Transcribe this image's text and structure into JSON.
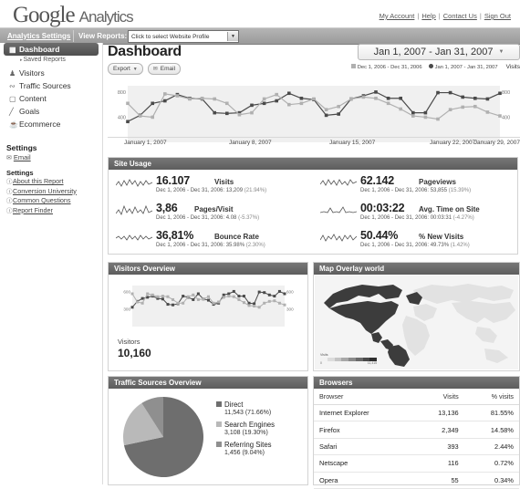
{
  "header": {
    "logo_google": "Google",
    "logo_product": "Analytics",
    "account_links": [
      "My Account",
      "Help",
      "Contact Us",
      "Sign Out"
    ]
  },
  "navbar": {
    "analytics_settings": "Analytics Settings",
    "view_reports_label": "View Reports:",
    "profile_placeholder": "Click to select Website Profile",
    "dropdown_icon": "chevron-down-icon"
  },
  "sidebar": {
    "items": [
      {
        "label": "Dashboard",
        "icon": "grid-icon",
        "active": true
      },
      {
        "label": "Visitors",
        "icon": "person-icon",
        "active": false
      },
      {
        "label": "Traffic Sources",
        "icon": "share-icon",
        "active": false
      },
      {
        "label": "Content",
        "icon": "document-icon",
        "active": false
      },
      {
        "label": "Goals",
        "icon": "flag-icon",
        "active": false
      },
      {
        "label": "Ecommerce",
        "icon": "cart-icon",
        "active": false
      }
    ],
    "saved_reports": "Saved Reports",
    "settings_heading": "Settings",
    "email_link": "Email",
    "email_icon": "envelope-icon",
    "help_heading": "Settings",
    "help_links": [
      "About this Report",
      "Conversion University",
      "Common Questions",
      "Report Finder"
    ]
  },
  "main": {
    "title": "Dashboard",
    "export_button": "Export",
    "email_button": "Email",
    "date_range": "Jan 1, 2007 - Jan 31, 2007",
    "legend": {
      "prev_period": "Dec 1, 2006 - Dec 31, 2006",
      "curr_period": "Jan 1, 2007 - Jan 31, 2007",
      "metric": "Visits"
    }
  },
  "site_usage": {
    "title": "Site Usage",
    "metrics": [
      {
        "value": "16.107",
        "label": "Visits",
        "compare_prefix": "Dec 1, 2006 - Dec 31, 2006: 13,209",
        "compare_pct": "(21.94%)"
      },
      {
        "value": "62.142",
        "label": "Pageviews",
        "compare_prefix": "Dec 1, 2006 - Dec 31, 2006: 53,855",
        "compare_pct": "(15.39%)"
      },
      {
        "value": "3,86",
        "label": "Pages/Visit",
        "compare_prefix": "Dec 1, 2006 - Dec 31, 2006: 4.08",
        "compare_pct": "(-5.37%)"
      },
      {
        "value": "00:03:22",
        "label": "Avg. Time on Site",
        "compare_prefix": "Dec 1, 2006 - Dec 31, 2006: 00:03:31",
        "compare_pct": "(-4.27%)"
      },
      {
        "value": "36,81%",
        "label": "Bounce Rate",
        "compare_prefix": "Dec 1, 2006 - Dec 31, 2006: 35.98%",
        "compare_pct": "(2.30%)"
      },
      {
        "value": "50.44%",
        "label": "% New Visits",
        "compare_prefix": "Dec 1, 2006 - Dec 31, 2006: 49.73%",
        "compare_pct": "(1.42%)"
      }
    ]
  },
  "visitors_overview": {
    "title": "Visitors Overview",
    "footer_label": "Visitors",
    "footer_value": "10,160"
  },
  "map_overlay": {
    "title": "Map Overlay world",
    "legend_title": "Visits",
    "legend_min": "0",
    "legend_max": "11,415"
  },
  "traffic_sources": {
    "title": "Traffic Sources Overview"
  },
  "browsers": {
    "title": "Browsers",
    "columns": [
      "Browser",
      "Visits",
      "% visits"
    ],
    "rows": [
      {
        "browser": "Internet Explorer",
        "visits": "13,136",
        "pct": "81.55%"
      },
      {
        "browser": "Firefox",
        "visits": "2,349",
        "pct": "14.58%"
      },
      {
        "browser": "Safari",
        "visits": "393",
        "pct": "2.44%"
      },
      {
        "browser": "Netscape",
        "visits": "116",
        "pct": "0.72%"
      },
      {
        "browser": "Opera",
        "visits": "55",
        "pct": "0.34%"
      }
    ]
  },
  "colors": {
    "current_series": "#4a4a4a",
    "previous_series": "#b0b0b0",
    "panel_header": "#5d5d5d",
    "pie_direct": "#6e6e6e",
    "pie_search": "#b9b9b9",
    "pie_referring": "#8f8f8f"
  },
  "chart_data": {
    "type": "line",
    "title": "Visits",
    "xlabel": "",
    "ylabel": "Visits",
    "ylim": [
      0,
      900
    ],
    "yticks": [
      400,
      800
    ],
    "xticks": [
      "January 1, 2007",
      "January 8, 2007",
      "January 15, 2007",
      "January 22, 2007",
      "January 29, 2007"
    ],
    "x": [
      1,
      2,
      3,
      4,
      5,
      6,
      7,
      8,
      9,
      10,
      11,
      12,
      13,
      14,
      15,
      16,
      17,
      18,
      19,
      20,
      21,
      22,
      23,
      24,
      25,
      26,
      27,
      28,
      29,
      30,
      31
    ],
    "series": [
      {
        "name": "Jan 1, 2007 - Jan 31, 2007",
        "color": "#4a4a4a",
        "values": [
          330,
          430,
          620,
          660,
          760,
          700,
          690,
          470,
          460,
          470,
          590,
          620,
          660,
          780,
          700,
          680,
          430,
          450,
          690,
          740,
          800,
          700,
          700,
          470,
          470,
          790,
          790,
          720,
          700,
          690,
          780
        ]
      },
      {
        "name": "Dec 1, 2006 - Dec 31, 2006",
        "color": "#b0b0b0",
        "values": [
          620,
          420,
          400,
          770,
          740,
          690,
          700,
          690,
          620,
          440,
          470,
          690,
          760,
          600,
          620,
          690,
          520,
          570,
          690,
          720,
          700,
          620,
          530,
          420,
          400,
          370,
          520,
          560,
          570,
          480,
          420
        ]
      }
    ]
  },
  "visitors_chart_data": {
    "type": "line",
    "yticks": [
      300,
      600
    ],
    "ylim": [
      0,
      700
    ],
    "series": [
      {
        "name": "current",
        "color": "#4a4a4a",
        "values": [
          330,
          430,
          480,
          500,
          520,
          480,
          470,
          380,
          370,
          390,
          520,
          500,
          460,
          560,
          470,
          450,
          380,
          400,
          540,
          560,
          600,
          520,
          520,
          400,
          390,
          590,
          580,
          540,
          520,
          600,
          560
        ]
      },
      {
        "name": "previous",
        "color": "#b0b0b0",
        "values": [
          560,
          420,
          400,
          560,
          540,
          510,
          520,
          510,
          460,
          400,
          400,
          510,
          540,
          460,
          470,
          510,
          400,
          420,
          500,
          520,
          510,
          460,
          410,
          360,
          350,
          330,
          400,
          430,
          440,
          400,
          370
        ]
      }
    ]
  },
  "pie_chart_data": {
    "type": "pie",
    "title": "Traffic Sources Overview",
    "labels": [
      "Direct",
      "Search Engines",
      "Referring Sites"
    ],
    "values": [
      11543,
      3108,
      1456
    ],
    "percents": [
      "71.66%",
      "19.30%",
      "9.04%"
    ],
    "value_labels": [
      "11,543 (71.66%)",
      "3,108 (19.30%)",
      "1,456 (9.04%)"
    ],
    "colors": [
      "#6e6e6e",
      "#b9b9b9",
      "#8f8f8f"
    ]
  },
  "browsers_chart_data": {
    "type": "table",
    "columns": [
      "Browser",
      "Visits",
      "% visits"
    ],
    "categories": [
      "Internet Explorer",
      "Firefox",
      "Safari",
      "Netscape",
      "Opera"
    ],
    "values": [
      13136,
      2349,
      393,
      116,
      55
    ],
    "percents": [
      81.55,
      14.58,
      2.44,
      0.72,
      0.34
    ]
  }
}
